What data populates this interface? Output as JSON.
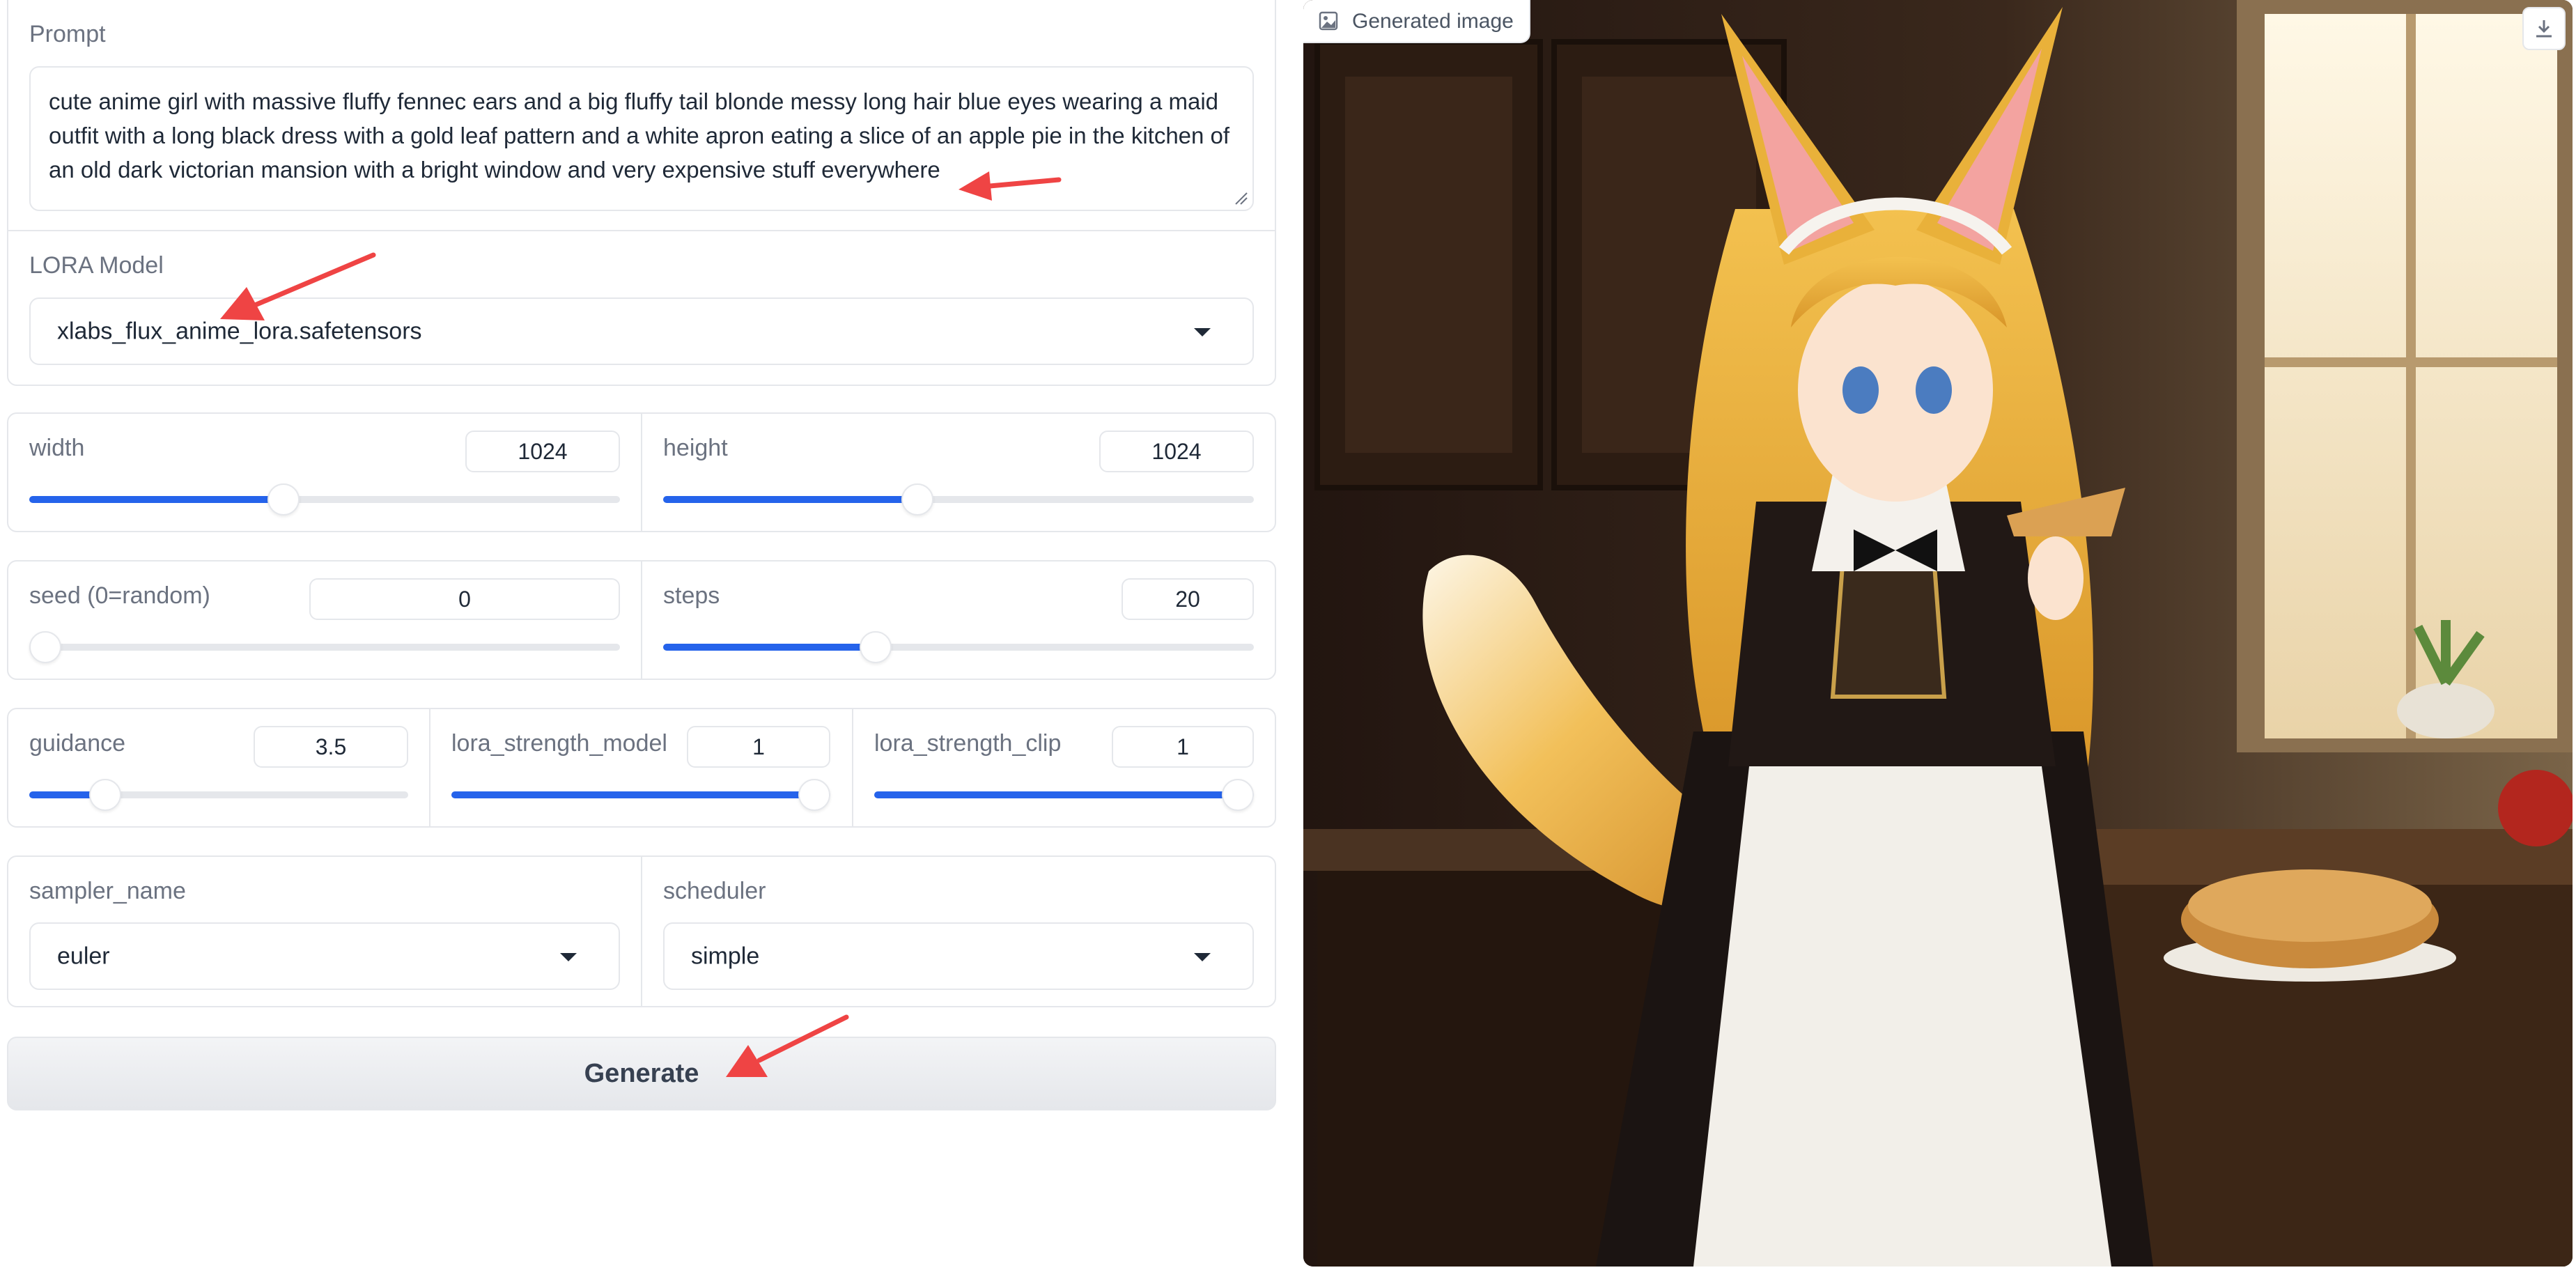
{
  "prompt": {
    "label": "Prompt",
    "value": "cute anime girl with massive fluffy fennec ears and a big fluffy tail blonde messy long hair blue eyes wearing a maid outfit with a long black dress with a gold leaf pattern and a white apron eating a slice of an apple pie in the kitchen of an old dark victorian mansion with a bright window and very expensive stuff everywhere"
  },
  "lora": {
    "label": "LORA Model",
    "selected": "xlabs_flux_anime_lora.safetensors"
  },
  "width": {
    "label": "width",
    "value": "1024",
    "fraction": 0.43
  },
  "height": {
    "label": "height",
    "value": "1024",
    "fraction": 0.43
  },
  "seed": {
    "label": "seed (0=random)",
    "value": "0",
    "fraction": 0.0
  },
  "steps": {
    "label": "steps",
    "value": "20",
    "fraction": 0.36
  },
  "guidance": {
    "label": "guidance",
    "value": "3.5",
    "fraction": 0.2
  },
  "lora_strength_model": {
    "label": "lora_strength_model",
    "value": "1",
    "fraction": 1.0
  },
  "lora_strength_clip": {
    "label": "lora_strength_clip",
    "value": "1",
    "fraction": 1.0
  },
  "sampler": {
    "label": "sampler_name",
    "selected": "euler"
  },
  "scheduler": {
    "label": "scheduler",
    "selected": "simple"
  },
  "generate": {
    "label": "Generate"
  },
  "output": {
    "label": "Generated image"
  },
  "colors": {
    "accent": "#2563eb",
    "annotation_arrow": "#ef4444",
    "border": "#e5e7eb"
  }
}
